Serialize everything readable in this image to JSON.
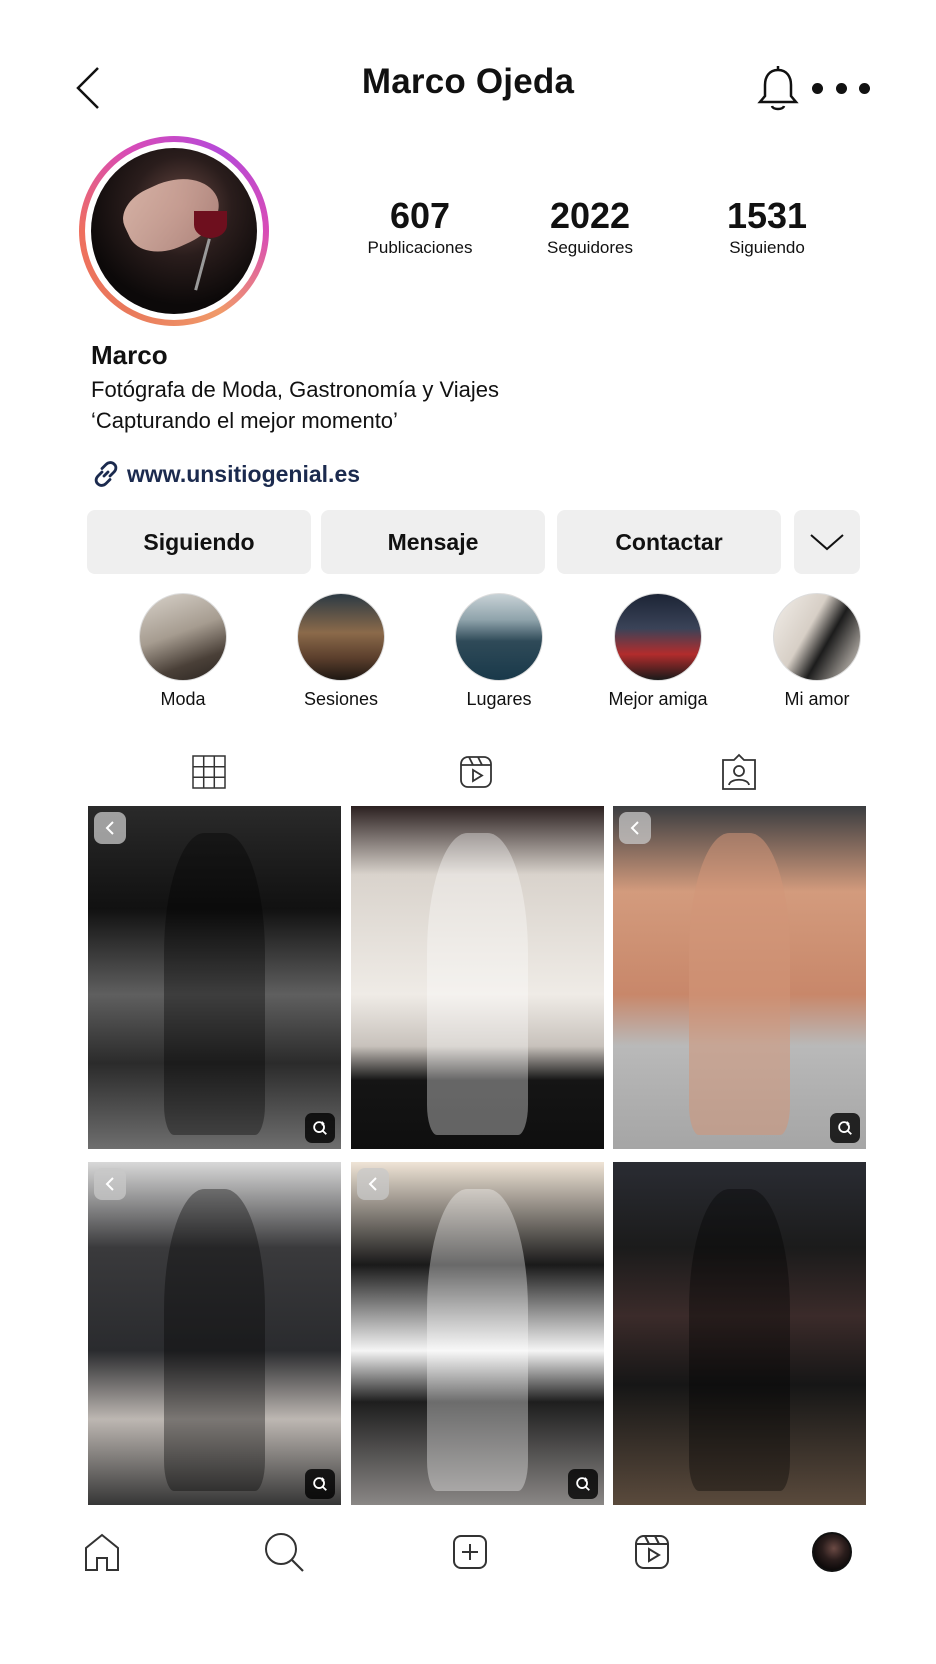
{
  "header": {
    "title": "Marco Ojeda",
    "back_icon": "chevron-left-icon",
    "notifications_icon": "bell-icon",
    "more_icon": "more-dots-icon"
  },
  "profile": {
    "name": "Marco",
    "bio_line1": "Fotógrafa de Moda, Gastronomía y Viajes",
    "bio_line2": "‘Capturando el mejor momento’",
    "link": "www.unsitiogenial.es",
    "stats": {
      "posts": {
        "value": "607",
        "label": "Publicaciones"
      },
      "followers": {
        "value": "2022",
        "label": "Seguidores"
      },
      "following": {
        "value": "1531",
        "label": "Siguiendo"
      }
    }
  },
  "buttons": {
    "following": "Siguiendo",
    "message": "Mensaje",
    "contact": "Contactar"
  },
  "highlights": [
    {
      "label": "Moda"
    },
    {
      "label": "Sesiones"
    },
    {
      "label": "Lugares"
    },
    {
      "label": "Mejor amiga"
    },
    {
      "label": "Mi amor"
    }
  ],
  "tabs": [
    "grid-icon",
    "reels-icon",
    "tagged-icon"
  ],
  "bottom_nav": [
    "home-icon",
    "search-icon",
    "create-icon",
    "reels-icon",
    "profile-avatar"
  ],
  "colors": {
    "link": "#1b2a4e",
    "button_bg": "#efefef",
    "story_ring_start": "#e9795b",
    "story_ring_end": "#b64ad8"
  }
}
